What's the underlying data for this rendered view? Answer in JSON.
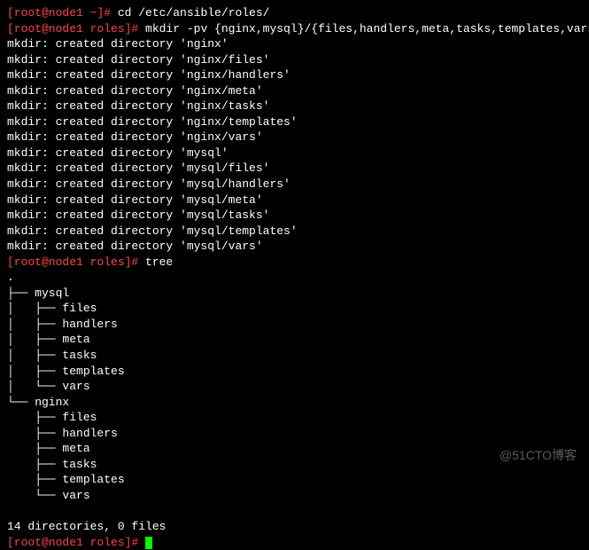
{
  "prompts": {
    "p1_user": "[root@node1 ~]# ",
    "p1_cmd": "cd /etc/ansible/roles/",
    "p2_user": "[root@node1 roles]# ",
    "p2_cmd": "mkdir -pv {nginx,mysql}/{files,handlers,meta,tasks,templates,vars}",
    "p3_user": "[root@node1 roles]# ",
    "p3_cmd": "tree",
    "p4_user": "[root@node1 roles]# "
  },
  "mkdir_output": [
    "mkdir: created directory 'nginx'",
    "mkdir: created directory 'nginx/files'",
    "mkdir: created directory 'nginx/handlers'",
    "mkdir: created directory 'nginx/meta'",
    "mkdir: created directory 'nginx/tasks'",
    "mkdir: created directory 'nginx/templates'",
    "mkdir: created directory 'nginx/vars'",
    "mkdir: created directory 'mysql'",
    "mkdir: created directory 'mysql/files'",
    "mkdir: created directory 'mysql/handlers'",
    "mkdir: created directory 'mysql/meta'",
    "mkdir: created directory 'mysql/tasks'",
    "mkdir: created directory 'mysql/templates'",
    "mkdir: created directory 'mysql/vars'"
  ],
  "tree_output": [
    ".",
    "├── mysql",
    "│   ├── files",
    "│   ├── handlers",
    "│   ├── meta",
    "│   ├── tasks",
    "│   ├── templates",
    "│   └── vars",
    "└── nginx",
    "    ├── files",
    "    ├── handlers",
    "    ├── meta",
    "    ├── tasks",
    "    ├── templates",
    "    └── vars"
  ],
  "tree_summary": "14 directories, 0 files",
  "watermark": "@51CTO博客"
}
